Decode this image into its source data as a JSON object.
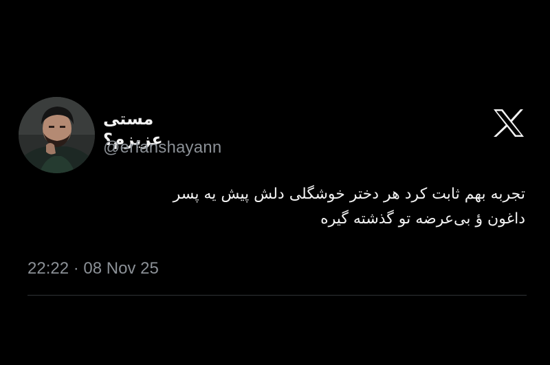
{
  "tweet": {
    "author": {
      "display_name": "مستی عزیزم؟",
      "handle": "@erfanshayann",
      "avatar_icon": "profile-photo"
    },
    "platform_icon": "x-logo-icon",
    "text_lines": [
      "تجربه بهم ثابت کرد هر دختر خوشگلی دلش پیش یه پسر",
      "داغون ؤ بی‌عرضه تو گذشته گیره"
    ],
    "timestamp": "22:22 · 08 Nov 25"
  },
  "colors": {
    "background": "#000000",
    "primary_text": "#f2f2f2",
    "secondary_text": "#8b9096",
    "divider": "#2f3336"
  }
}
